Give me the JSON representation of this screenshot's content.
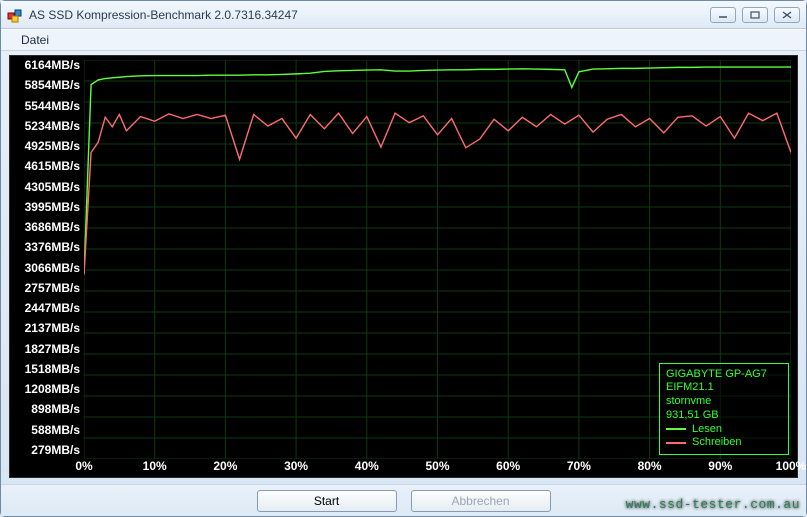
{
  "window": {
    "title": "AS SSD Kompression-Benchmark 2.0.7316.34247"
  },
  "menu": {
    "file": "Datei"
  },
  "buttons": {
    "start": "Start",
    "cancel": "Abbrechen"
  },
  "legend": {
    "device": "GIGABYTE GP-AG7",
    "fw": "EIFM21.1",
    "driver": "stornvme",
    "size": "931,51 GB",
    "read_label": "Lesen",
    "write_label": "Schreiben"
  },
  "watermark": "www.ssd-tester.com.au",
  "chart_data": {
    "type": "line",
    "title": "",
    "xlabel": "",
    "ylabel": "",
    "x_unit": "%",
    "y_unit": "MB/s",
    "xlim": [
      0,
      100
    ],
    "ylim": [
      279,
      6164
    ],
    "y_ticks": [
      6164,
      5854,
      5544,
      5234,
      4925,
      4615,
      4305,
      3995,
      3686,
      3376,
      3066,
      2757,
      2447,
      2137,
      1827,
      1518,
      1208,
      898,
      588,
      279
    ],
    "x_ticks": [
      0,
      10,
      20,
      30,
      40,
      50,
      60,
      70,
      80,
      90,
      100
    ],
    "colors": {
      "read": "#5bff3b",
      "write": "#ff6a70",
      "grid": "#0e3a0e"
    },
    "series": [
      {
        "name": "Lesen",
        "color": "#5bff3b",
        "x": [
          0,
          1,
          2,
          3,
          4,
          5,
          6,
          8,
          10,
          12,
          14,
          16,
          18,
          20,
          22,
          24,
          26,
          28,
          30,
          32,
          34,
          36,
          38,
          40,
          42,
          44,
          46,
          48,
          50,
          52,
          54,
          56,
          58,
          60,
          62,
          64,
          66,
          68,
          69,
          70,
          72,
          74,
          76,
          78,
          80,
          82,
          84,
          86,
          88,
          90,
          92,
          94,
          96,
          98,
          100
        ],
        "y": [
          3000,
          5800,
          5870,
          5890,
          5900,
          5910,
          5920,
          5930,
          5935,
          5935,
          5935,
          5935,
          5940,
          5940,
          5940,
          5945,
          5945,
          5950,
          5960,
          5970,
          5995,
          6005,
          6010,
          6015,
          6020,
          6000,
          6000,
          6010,
          6015,
          6020,
          6020,
          6025,
          6025,
          6030,
          6035,
          6030,
          6025,
          6020,
          5760,
          5990,
          6030,
          6035,
          6040,
          6040,
          6045,
          6050,
          6055,
          6055,
          6060,
          6060,
          6060,
          6060,
          6060,
          6060,
          6060
        ]
      },
      {
        "name": "Schreiben",
        "color": "#ff6a70",
        "x": [
          0,
          1,
          2,
          3,
          4,
          5,
          6,
          8,
          10,
          12,
          14,
          16,
          18,
          20,
          22,
          24,
          26,
          28,
          30,
          32,
          34,
          36,
          38,
          40,
          42,
          44,
          46,
          48,
          50,
          52,
          54,
          56,
          58,
          60,
          62,
          64,
          66,
          68,
          70,
          72,
          74,
          76,
          78,
          80,
          82,
          84,
          86,
          88,
          90,
          92,
          94,
          96,
          98,
          100
        ],
        "y": [
          3000,
          4800,
          4950,
          5320,
          5180,
          5360,
          5120,
          5330,
          5260,
          5370,
          5300,
          5360,
          5300,
          5350,
          4700,
          5360,
          5190,
          5300,
          5010,
          5360,
          5150,
          5380,
          5080,
          5330,
          4880,
          5380,
          5240,
          5340,
          5060,
          5300,
          4870,
          5000,
          5290,
          5120,
          5320,
          5180,
          5360,
          5220,
          5350,
          5100,
          5290,
          5360,
          5180,
          5300,
          5090,
          5320,
          5340,
          5190,
          5330,
          5010,
          5380,
          5270,
          5380,
          4800
        ]
      }
    ]
  }
}
